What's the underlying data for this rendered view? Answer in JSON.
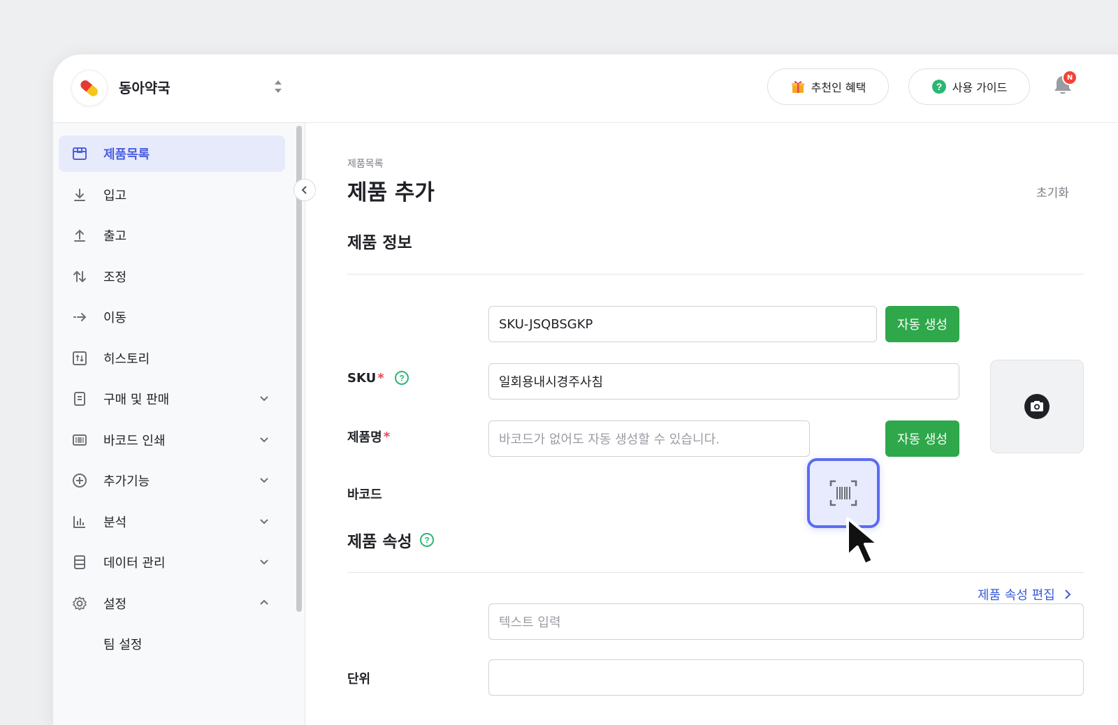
{
  "header": {
    "company_name": "동아약국",
    "referral_label": "추천인 혜택",
    "guide_label": "사용 가이드",
    "notification_badge": "N"
  },
  "sidebar": {
    "items": [
      {
        "label": "제품목록",
        "icon": "box-icon",
        "active": true
      },
      {
        "label": "입고",
        "icon": "arrow-down-icon"
      },
      {
        "label": "출고",
        "icon": "arrow-up-icon"
      },
      {
        "label": "조정",
        "icon": "swap-vertical-icon"
      },
      {
        "label": "이동",
        "icon": "arrow-right-icon"
      },
      {
        "label": "히스토리",
        "icon": "history-icon"
      },
      {
        "label": "구매 및 판매",
        "icon": "document-icon",
        "chevron": "down"
      },
      {
        "label": "바코드 인쇄",
        "icon": "barcode-icon",
        "chevron": "down"
      },
      {
        "label": "추가기능",
        "icon": "plus-circle-icon",
        "chevron": "down"
      },
      {
        "label": "분석",
        "icon": "bar-chart-icon",
        "chevron": "down"
      },
      {
        "label": "데이터 관리",
        "icon": "database-icon",
        "chevron": "down"
      },
      {
        "label": "설정",
        "icon": "gear-icon",
        "chevron": "up"
      }
    ],
    "subitems": [
      "팀 설정"
    ]
  },
  "main": {
    "breadcrumb": "제품목록",
    "title": "제품 추가",
    "reset_label": "초기화",
    "product_info": {
      "section_title": "제품 정보",
      "sku_label": "SKU",
      "sku_value": "SKU-JSQBSGKP",
      "name_label": "제품명",
      "name_value": "일회용내시경주사침",
      "barcode_label": "바코드",
      "barcode_placeholder": "바코드가 없어도 자동 생성할 수 있습니다.",
      "auto_generate_label": "자동 생성",
      "required_mark": "*"
    },
    "attributes": {
      "section_title": "제품 속성",
      "edit_link": "제품 속성 편집",
      "unit_label": "단위",
      "unit_placeholder": "텍스트 입력"
    }
  },
  "colors": {
    "accent": "#4a5fe2",
    "generate_button": "#2ea84a",
    "required": "#e5484d",
    "help_icon": "#2bb673",
    "link": "#3b5bdb"
  }
}
